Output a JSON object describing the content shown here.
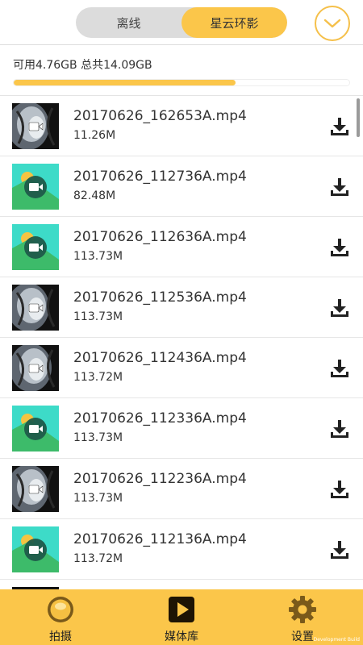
{
  "header": {
    "tabs": [
      {
        "label": "离线",
        "active": false
      },
      {
        "label": "星云环影",
        "active": true
      }
    ],
    "dropdown_icon": "chevron-down-icon"
  },
  "storage": {
    "text": "可用4.76GB 总共14.09GB",
    "used_fraction": 0.662
  },
  "files": [
    {
      "name": "20170626_162653A.mp4",
      "size": "11.26M",
      "thumb": "fisheye"
    },
    {
      "name": "20170626_112736A.mp4",
      "size": "82.48M",
      "thumb": "placeholder"
    },
    {
      "name": "20170626_112636A.mp4",
      "size": "113.73M",
      "thumb": "placeholder"
    },
    {
      "name": "20170626_112536A.mp4",
      "size": "113.73M",
      "thumb": "fisheye"
    },
    {
      "name": "20170626_112436A.mp4",
      "size": "113.72M",
      "thumb": "fisheye"
    },
    {
      "name": "20170626_112336A.mp4",
      "size": "113.73M",
      "thumb": "placeholder"
    },
    {
      "name": "20170626_112236A.mp4",
      "size": "113.73M",
      "thumb": "fisheye"
    },
    {
      "name": "20170626_112136A.mp4",
      "size": "113.72M",
      "thumb": "placeholder"
    }
  ],
  "tabbar": {
    "items": [
      {
        "label": "拍摄",
        "icon": "camera-lens-icon"
      },
      {
        "label": "媒体库",
        "icon": "play-icon"
      },
      {
        "label": "设置",
        "icon": "gear-icon"
      }
    ]
  },
  "watermark": "Development Build",
  "colors": {
    "accent": "#fbc64a",
    "thumb_bg": "#3ddbc8",
    "thumb_hill": "#3dbb6a",
    "thumb_sun": "#f5c442"
  }
}
